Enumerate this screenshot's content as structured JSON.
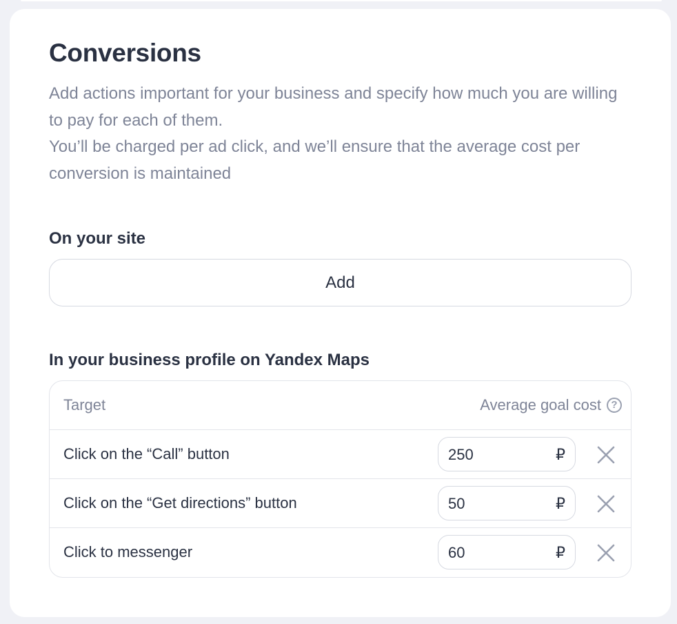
{
  "conversions": {
    "title": "Conversions",
    "description": [
      "Add actions important for your business and specify how much you are willing to pay for each of them.",
      "You’ll be charged per ad click, and we’ll ensure that the average cost per conversion is maintained"
    ]
  },
  "site_section": {
    "label": "On your site",
    "add_label": "Add"
  },
  "maps_section": {
    "label": "In your business profile on Yandex Maps",
    "columns": {
      "target": "Target",
      "cost": "Average goal cost"
    },
    "help_glyph": "?",
    "currency": "₽",
    "rows": [
      {
        "label": "Click on the “Call” button",
        "value": "250"
      },
      {
        "label": "Click on the “Get directions” button",
        "value": "50"
      },
      {
        "label": "Click to messenger",
        "value": "60"
      }
    ]
  },
  "icons": {
    "help": "question-circle-icon",
    "remove": "close-icon"
  },
  "colors": {
    "background": "#f0f1f6",
    "card": "#ffffff",
    "text": "#2a3142",
    "muted": "#7e8497",
    "border": "#e2e4ea"
  }
}
